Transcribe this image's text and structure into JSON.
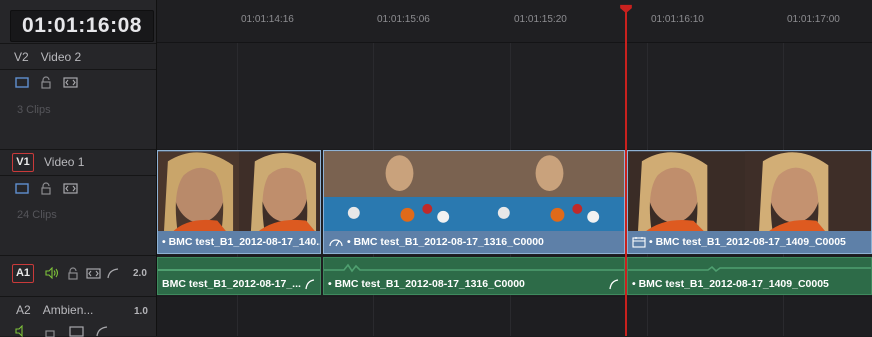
{
  "timecode": "01:01:16:08",
  "ruler": {
    "ticks": [
      "01:01:14:16",
      "01:01:15:06",
      "01:01:15:20",
      "01:01:16:10",
      "01:01:17:00"
    ]
  },
  "tracks": {
    "v2": {
      "id": "V2",
      "name": "Video 2",
      "clips_count": "3 Clips"
    },
    "v1": {
      "id": "V1",
      "name": "Video 1",
      "clips_count": "24 Clips"
    },
    "a1": {
      "id": "A1",
      "gain": "2.0"
    },
    "a2": {
      "id": "A2",
      "name": "Ambien...",
      "gain": "1.0"
    }
  },
  "video_clips": [
    {
      "label": "• BMC test_B1_2012-08-17_140..."
    },
    {
      "label": "• BMC test_B1_2012-08-17_1316_C0000"
    },
    {
      "label": "• BMC test_B1_2012-08-17_1409_C0005"
    }
  ],
  "audio_clips": [
    {
      "label": "BMC test_B1_2012-08-17_..."
    },
    {
      "label": "• BMC test_B1_2012-08-17_1316_C0000"
    },
    {
      "label": "• BMC test_B1_2012-08-17_1409_C0005"
    }
  ],
  "colors": {
    "playhead": "#c9211e",
    "video_clip": "#5f7fa3",
    "audio_clip": "#2d6b48",
    "track_select": "#c93a3a",
    "icon_blue": "#5f8fcf",
    "speaker_green": "#7ec23a"
  },
  "icons": [
    "monitor-icon",
    "lock-icon",
    "auto-select-icon",
    "speaker-icon",
    "curve-icon",
    "speed-icon",
    "calendar-icon"
  ]
}
